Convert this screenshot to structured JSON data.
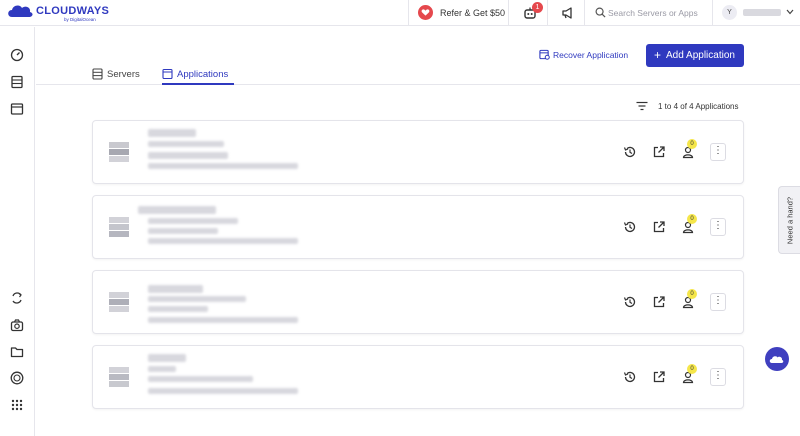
{
  "brand": {
    "name": "CLOUDWAYS",
    "sub": "by DigitalOcean"
  },
  "topbar": {
    "refer_label": "Refer & Get $50",
    "notification_count": "1",
    "search_placeholder": "Search Servers or Apps",
    "user_initial": "Y"
  },
  "sidebar": {
    "items": [
      {
        "icon": "dashboard-gauge-icon"
      },
      {
        "icon": "servers-icon"
      },
      {
        "icon": "applications-icon"
      },
      {
        "icon": "migration-icon"
      },
      {
        "icon": "addons-icon"
      },
      {
        "icon": "projects-folder-icon"
      },
      {
        "icon": "billing-icon"
      },
      {
        "icon": "apps-grid-icon"
      }
    ]
  },
  "actions": {
    "recover_label": "Recover Application",
    "add_label": "Add Application"
  },
  "tabs": [
    {
      "label": "Servers",
      "active": false
    },
    {
      "label": "Applications",
      "active": true
    }
  ],
  "list_count": "1 to 4 of 4 Applications",
  "applications": [
    {
      "collaborators": "0"
    },
    {
      "collaborators": "0"
    },
    {
      "collaborators": "0"
    },
    {
      "collaborators": "0"
    }
  ],
  "help": {
    "need_hand": "Need a hand?"
  },
  "colors": {
    "accent": "#2f39bf",
    "alert": "#e5484d",
    "badge": "#f5e64a"
  }
}
